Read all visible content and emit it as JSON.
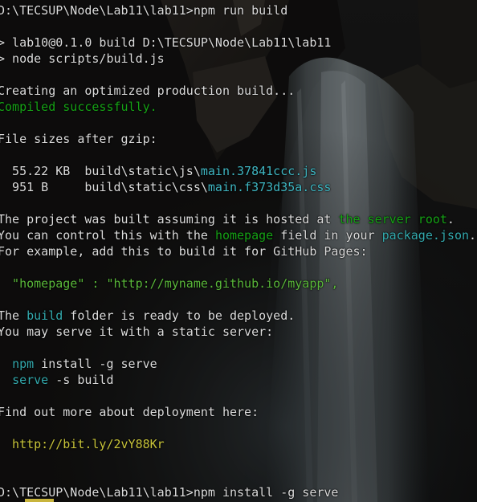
{
  "terminal": {
    "lines": {
      "l1": {
        "text": "D:\\TECSUP\\Node\\Lab11\\lab11>npm run build"
      },
      "l2": {
        "text": "> lab10@0.1.0 build D:\\TECSUP\\Node\\Lab11\\lab11"
      },
      "l3": {
        "text": "> node scripts/build.js"
      },
      "l4": {
        "text": "Creating an optimized production build..."
      },
      "l5": {
        "text": "Compiled successfully."
      },
      "l6": {
        "text": "File sizes after gzip:"
      },
      "l7": {
        "size": "  55.22 KB",
        "path": "  build\\static\\js\\",
        "file": "main.37841ccc.js"
      },
      "l8": {
        "size": "  951 B   ",
        "path": "  build\\static\\css\\",
        "file": "main.f373d35a.css"
      },
      "l9": {
        "a": "The project was built assuming it is hosted at ",
        "b": "the server root",
        "c": "."
      },
      "l10": {
        "a": "You can control this with the ",
        "b": "homepage",
        "c": " field in your ",
        "d": "package.json",
        "e": "."
      },
      "l11": {
        "text": "For example, add this to build it for GitHub Pages:"
      },
      "l12": {
        "text": "  \"homepage\" : \"http://myname.github.io/myapp\","
      },
      "l13": {
        "a": "The ",
        "b": "build",
        "c": " folder is ready to be deployed."
      },
      "l14": {
        "text": "You may serve it with a static server:"
      },
      "l15": {
        "a": "  ",
        "b": "npm",
        "c": " install -g serve"
      },
      "l16": {
        "a": "  ",
        "b": "serve",
        "c": " -s build"
      },
      "l17": {
        "text": "Find out more about deployment here:"
      },
      "l18": {
        "text": "  http://bit.ly/2vY88Kr"
      },
      "l19": {
        "text": "D:\\TECSUP\\Node\\Lab11\\lab11>npm install -g serve"
      }
    }
  },
  "colors": {
    "success": "#16a316",
    "highlight_cyan": "#33a9ad",
    "link_yellow": "#c8c43a",
    "cursor": "#c8b43c"
  }
}
